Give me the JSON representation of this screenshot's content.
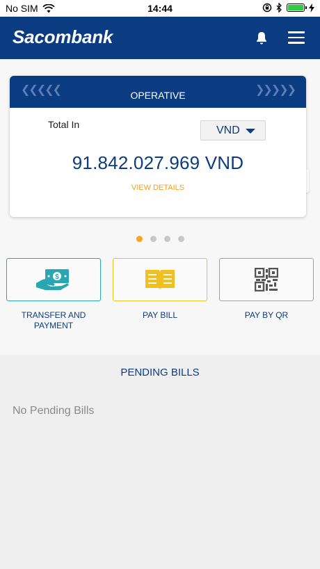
{
  "status_bar": {
    "carrier": "No SIM",
    "time": "14:44"
  },
  "header": {
    "brand": "Sacombank"
  },
  "account_card": {
    "type": "OPERATIVE",
    "total_label": "Total In",
    "currency": "VND",
    "balance_amount": "91.842.027.969",
    "balance_currency": "VND",
    "view_details": "VIEW DETAILS"
  },
  "pager": {
    "count": 4,
    "active_index": 0
  },
  "actions": [
    {
      "label_line1": "TRANSFER AND",
      "label_line2": "PAYMENT"
    },
    {
      "label_line1": "PAY BILL",
      "label_line2": ""
    },
    {
      "label_line1": "PAY BY QR",
      "label_line2": ""
    }
  ],
  "pending": {
    "title": "PENDING BILLS",
    "empty_text": "No Pending Bills"
  },
  "colors": {
    "primary": "#0b3b80",
    "accent": "#f5a623",
    "transfer_icon": "#2aa6b3",
    "paybill_icon": "#f0c020"
  }
}
